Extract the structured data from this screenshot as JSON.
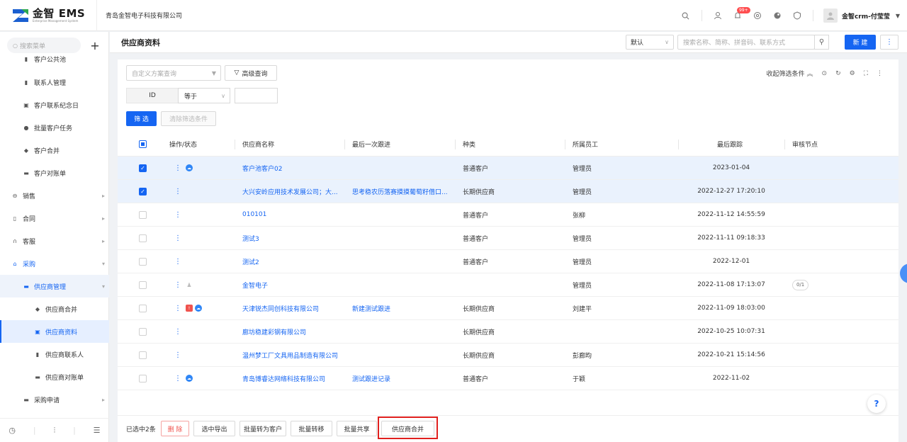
{
  "header": {
    "logo_title": "金智 EMS",
    "logo_sub": "Enterprise Management System",
    "company": "青岛金智电子科技有限公司",
    "badge": "99+",
    "user_name": "金智crm-付莹莹",
    "icons": [
      "search-icon",
      "contacts-icon",
      "bell-icon",
      "settings-icon",
      "theme-icon",
      "shield-icon"
    ]
  },
  "sidebar": {
    "search_placeholder": "搜索菜单",
    "add_label": "+",
    "items": [
      {
        "label": "客户公共池",
        "icon": "pool-icon"
      },
      {
        "label": "联系人管理",
        "icon": "contact-icon"
      },
      {
        "label": "客户联系纪念日",
        "icon": "calendar-icon"
      },
      {
        "label": "批量客户任务",
        "icon": "task-icon"
      },
      {
        "label": "客户合并",
        "icon": "merge-icon"
      },
      {
        "label": "客户对账单",
        "icon": "statement-icon"
      },
      {
        "label": "销售",
        "icon": "sales-icon"
      },
      {
        "label": "合同",
        "icon": "contract-icon"
      },
      {
        "label": "客服",
        "icon": "service-icon"
      },
      {
        "label": "采购",
        "icon": "purchase-icon"
      },
      {
        "label": "供应商管理",
        "icon": "folder-icon"
      },
      {
        "label": "供应商合并",
        "icon": "merge-icon"
      },
      {
        "label": "供应商资料",
        "icon": "info-icon"
      },
      {
        "label": "供应商联系人",
        "icon": "contact-icon"
      },
      {
        "label": "供应商对账单",
        "icon": "statement-icon"
      },
      {
        "label": "采购申请",
        "icon": "folder-icon"
      }
    ],
    "bottom_icons": [
      "history-icon",
      "filter-icon",
      "menu-icon"
    ]
  },
  "titlebar": {
    "title": "供应商资料",
    "view_select": "默认",
    "search_placeholder": "搜索名称、简称、拼音码、联系方式",
    "new_label": "新 建",
    "more_label": "⋮"
  },
  "filter": {
    "scheme_placeholder": "自定义方案查询",
    "advanced_label": "高级查询",
    "field_name": "ID",
    "operator": "等于",
    "filter_label": "筛 选",
    "clear_label": "清除筛选条件",
    "collapse_label": "收起筛选条件"
  },
  "table": {
    "columns": [
      "操作/状态",
      "供应商名称",
      "最后一次跟进",
      "种类",
      "所属员工",
      "最后跟踪",
      "审核节点"
    ],
    "rows": [
      {
        "checked": true,
        "status": [
          "blue"
        ],
        "name": "客户池客户02",
        "followup": "",
        "type": "普通客户",
        "staff": "管理员",
        "last": "2023-01-04",
        "node": ""
      },
      {
        "checked": true,
        "status": [],
        "name": "大兴安岭应用技术发展公司；大...",
        "followup": "思考稳农历落赛摸摸葡萄籽借口...",
        "type": "长期供应商",
        "staff": "管理员",
        "last": "2022-12-27 17:20:10",
        "node": ""
      },
      {
        "checked": false,
        "status": [],
        "name": "010101",
        "followup": "",
        "type": "普通客户",
        "staff": "张柳",
        "last": "2022-11-12 14:55:59",
        "node": ""
      },
      {
        "checked": false,
        "status": [],
        "name": "测试3",
        "followup": "",
        "type": "普通客户",
        "staff": "管理员",
        "last": "2022-11-11 09:18:33",
        "node": ""
      },
      {
        "checked": false,
        "status": [],
        "name": "测试2",
        "followup": "",
        "type": "普通客户",
        "staff": "管理员",
        "last": "2022-12-01",
        "node": ""
      },
      {
        "checked": false,
        "status": [
          "grey"
        ],
        "name": "金智电子",
        "followup": "",
        "type": "",
        "staff": "管理员",
        "last": "2022-11-08 17:13:07",
        "node": "0/1"
      },
      {
        "checked": false,
        "status": [
          "red",
          "blue"
        ],
        "name": "天津锐杰同创科技有限公司",
        "followup": "新建测试跟进",
        "type": "长期供应商",
        "staff": "刘建平",
        "last": "2022-11-09 18:03:00",
        "node": ""
      },
      {
        "checked": false,
        "status": [],
        "name": "廊坊稳建彩钢有限公司",
        "followup": "",
        "type": "长期供应商",
        "staff": "",
        "last": "2022-10-25 10:07:31",
        "node": ""
      },
      {
        "checked": false,
        "status": [],
        "name": "温州梦工厂文具用品制造有限公司",
        "followup": "",
        "type": "长期供应商",
        "staff": "彭廊昀",
        "last": "2022-10-21 15:14:56",
        "node": ""
      },
      {
        "checked": false,
        "status": [
          "blue"
        ],
        "name": "青岛博睿达网络科技有限公司",
        "followup": "测试跟进记录",
        "type": "普通客户",
        "staff": "于颖",
        "last": "2022-11-02",
        "node": ""
      }
    ]
  },
  "footer": {
    "selected_text": "已选中2条",
    "delete_label": "删 除",
    "export_label": "选中导出",
    "to_customer_label": "批量转为客户",
    "transfer_label": "批量转移",
    "share_label": "批量共享",
    "merge_label": "供应商合并"
  },
  "colors": {
    "accent": "#1565f2",
    "danger": "#f0534e",
    "highlight": "#e0201e"
  }
}
